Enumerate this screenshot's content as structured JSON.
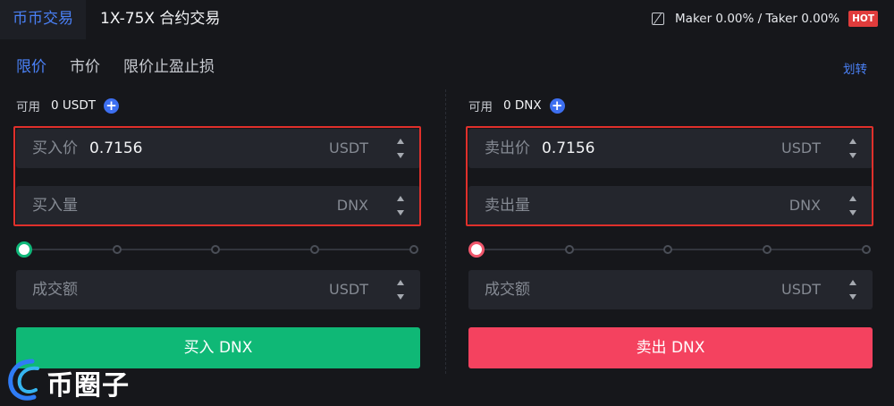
{
  "topbar": {
    "tab_spot": "币币交易",
    "tab_futures": "1X-75X 合约交易",
    "fee_text": "Maker 0.00% / Taker 0.00%",
    "hot_badge": "HOT"
  },
  "order_tabs": [
    {
      "label": "限价",
      "active": true
    },
    {
      "label": "市价",
      "active": false
    },
    {
      "label": "限价止盈止损",
      "active": false
    }
  ],
  "transfer_label": "划转",
  "buy": {
    "available_label": "可用",
    "available_value": "0 USDT",
    "price_label": "买入价",
    "price_value": "0.7156",
    "price_unit": "USDT",
    "amount_label": "买入量",
    "amount_unit": "DNX",
    "total_label": "成交额",
    "total_unit": "USDT",
    "slider_percent": 0,
    "button_label": "买入 DNX"
  },
  "sell": {
    "available_label": "可用",
    "available_value": "0 DNX",
    "price_label": "卖出价",
    "price_value": "0.7156",
    "price_unit": "USDT",
    "amount_label": "卖出量",
    "amount_unit": "DNX",
    "total_label": "成交额",
    "total_unit": "USDT",
    "slider_percent": 0,
    "button_label": "卖出 DNX"
  },
  "watermark": "币圈子",
  "colors": {
    "accent": "#4a80f5",
    "buy": "#0fb876",
    "sell": "#f4425f",
    "highlight": "#e0302b",
    "hot": "#e03c3c"
  }
}
